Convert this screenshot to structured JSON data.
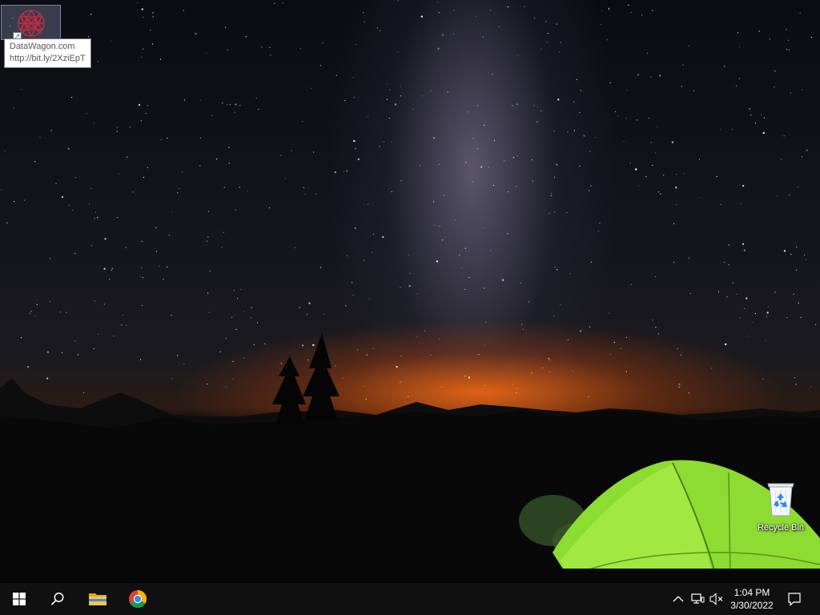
{
  "desktop": {
    "shortcut": {
      "name": "DataWagon.com",
      "icon": "datawagon-logo-icon"
    },
    "tooltip": {
      "line1": "DataWagon.com",
      "line2": "http://bit.ly/2XziEpT"
    },
    "recycle_bin": {
      "label": "Recycle Bin",
      "icon": "recycle-bin-icon"
    },
    "wallpaper": "night sky with milky way, tent glowing green"
  },
  "taskbar": {
    "pinned": [
      {
        "name": "start",
        "icon": "windows-logo-icon"
      },
      {
        "name": "search",
        "icon": "search-icon"
      },
      {
        "name": "file-explorer",
        "icon": "folder-icon"
      },
      {
        "name": "chrome",
        "icon": "chrome-icon"
      }
    ],
    "tray": {
      "chevron_icon": "chevron-up-icon",
      "network_icon": "network-icon",
      "volume_icon": "volume-muted-icon"
    },
    "clock": {
      "time": "1:04 PM",
      "date": "3/30/2022"
    },
    "notification_icon": "action-center-icon"
  },
  "colors": {
    "taskbar_bg": "#101010",
    "tent_green": "#7fd62a",
    "horizon_glow": "#ff6e14"
  }
}
